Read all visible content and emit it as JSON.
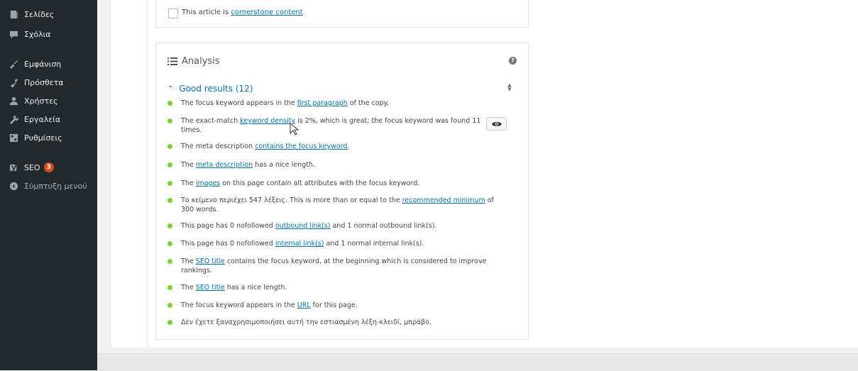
{
  "sidebar": {
    "items": [
      {
        "label": "Σελίδες",
        "icon": "pages-icon"
      },
      {
        "label": "Σχόλια",
        "icon": "comments-icon"
      },
      {
        "label": "Εμφάνιση",
        "icon": "appearance-icon"
      },
      {
        "label": "Πρόσθετα",
        "icon": "plugins-icon"
      },
      {
        "label": "Χρήστες",
        "icon": "users-icon"
      },
      {
        "label": "Εργαλεία",
        "icon": "tools-icon"
      },
      {
        "label": "Ρυθμίσεις",
        "icon": "settings-icon"
      },
      {
        "label": "SEO",
        "icon": "yoast-icon",
        "badge": "3"
      },
      {
        "label": "Σύμπτυξη μενού",
        "icon": "collapse-icon"
      }
    ]
  },
  "cornerstone": {
    "text_prefix": "This article is ",
    "link": "cornerstone content"
  },
  "analysis": {
    "title": "Analysis",
    "help": "?",
    "group_label": "Good results (12)",
    "results": [
      {
        "pre": "The focus keyword appears in the ",
        "link": "first paragraph",
        "post": " of the copy."
      },
      {
        "pre": "The exact-match ",
        "link": "keyword density",
        "post": " is 2%, which is great; the focus keyword was found 11 times."
      },
      {
        "pre": "The meta description ",
        "link": "contains the focus keyword",
        "post": "."
      },
      {
        "pre": "The ",
        "link": "meta description",
        "post": " has a nice length."
      },
      {
        "pre": "The ",
        "link": "images",
        "post": " on this page contain alt attributes with the focus keyword."
      },
      {
        "pre": "Το κείμενο περιέχει 547 λέξεις. This is more than or equal to the ",
        "link": "recommended minimum",
        "post": " of 300 words."
      },
      {
        "pre": "This page has 0 nofollowed ",
        "link": "outbound link(s)",
        "post": " and 1 normal outbound link(s)."
      },
      {
        "pre": "This page has 0 nofollowed ",
        "link": "internal link(s)",
        "post": " and 1 normal internal link(s)."
      },
      {
        "pre": "The ",
        "link": "SEO title",
        "post": " contains the focus keyword, at the beginning which is considered to improve rankings."
      },
      {
        "pre": "The ",
        "link": "SEO title",
        "post": " has a nice length."
      },
      {
        "pre": "The focus keyword appears in the ",
        "link": "URL",
        "post": " for this page."
      },
      {
        "pre": "Δεν έχετε ξαναχρησιμοποιήσει αυτή την εστιασμένη λέξη-κλειδί, μπράβο.",
        "link": "",
        "post": ""
      }
    ]
  },
  "colors": {
    "sidebar_bg": "#23282d",
    "link": "#0073aa",
    "good": "#7ad03a",
    "badge": "#d54e21"
  }
}
